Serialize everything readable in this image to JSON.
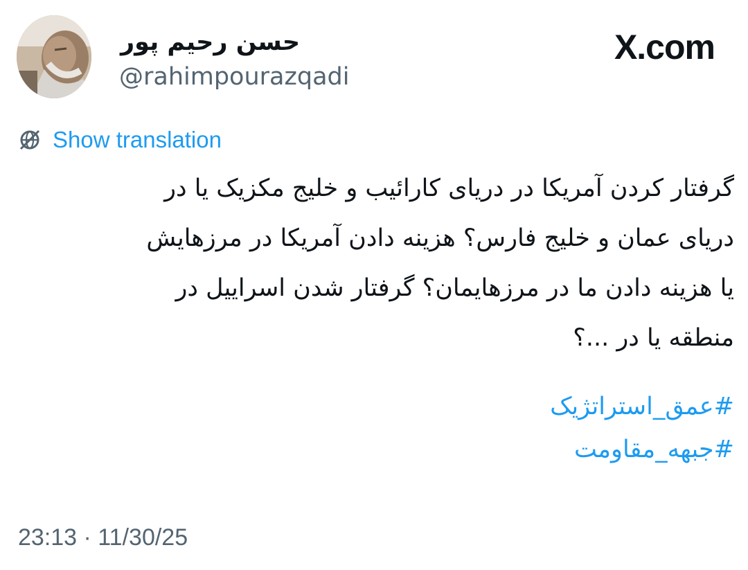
{
  "header": {
    "display_name": "حسن رحیم پور",
    "handle": "@rahimpourazqadi",
    "brand": "X.com"
  },
  "translation": {
    "label": "Show translation",
    "icon": "globe-icon"
  },
  "tweet": {
    "lines": [
      "گرفتار کردن آمریکا در دریای کارائیب و خلیج مکزیک یا در",
      "دریای عمان و خلیج فارس؟ هزینه دادن آمریکا در مرزهایش",
      "یا هزینه دادن ما در مرزهایمان؟ گرفتار شدن اسراییل در",
      "منطقه یا در ...؟"
    ],
    "hashtags": [
      "#عمق_استراتژیک",
      "#جبهه_مقاومت"
    ]
  },
  "footer": {
    "timestamp": "23:13 · 11/30/25"
  },
  "colors": {
    "link": "#1d9bf0",
    "secondary_text": "#536471",
    "primary_text": "#0f1419",
    "background": "#ffffff"
  }
}
